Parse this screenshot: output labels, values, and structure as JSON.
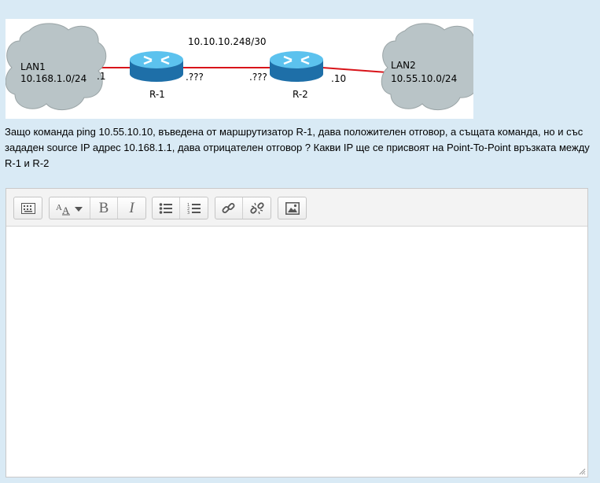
{
  "diagram": {
    "link_subnet": "10.10.10.248/30",
    "lan1": {
      "name": "LAN1",
      "network": "10.168.1.0/24",
      "iface": ".1"
    },
    "lan2": {
      "name": "LAN2",
      "network": "10.55.10.0/24",
      "iface": ".10"
    },
    "r1": {
      "name": "R-1",
      "iface": ".???"
    },
    "r2": {
      "name": "R-2",
      "iface": ".???"
    },
    "colors": {
      "cloud": "#b9c4c7",
      "router": "#2e9fd6",
      "lan_link": "#d8141a",
      "p2p_link": "#d8141a"
    }
  },
  "question": {
    "text": "Защо команда ping 10.55.10.10, въведена от маршрутизатор R-1, дава положителен отговор, а същата команда, но и със зададен source IP адрес 10.168.1.1, дава отрицателен отговор ? Какви IP ще се присвоят на Point-To-Point връзката между R-1 и R-2"
  },
  "editor": {
    "toolbar": {
      "show_more": "toolbar-toggle-icon",
      "font_style": "font-style-icon",
      "bold": "B",
      "italic": "I",
      "unordered_list": "unordered-list-icon",
      "ordered_list": "ordered-list-icon",
      "link": "link-icon",
      "unlink": "unlink-icon",
      "image": "image-icon"
    },
    "content": ""
  }
}
